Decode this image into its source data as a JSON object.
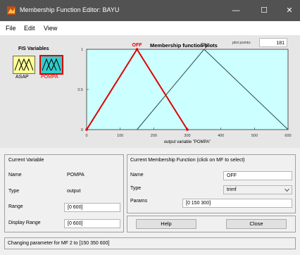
{
  "window": {
    "title": "Membership Function Editor: BAYU",
    "minimize": "—",
    "maximize": "☐",
    "close": "✕"
  },
  "menu": [
    "File",
    "Edit",
    "View"
  ],
  "fis_variables": {
    "title": "FIS Variables",
    "items": [
      {
        "label": "ASAP",
        "selected": false,
        "color": "#000000"
      },
      {
        "label": "POMPA",
        "selected": true,
        "color": "#e00000"
      }
    ]
  },
  "plot": {
    "title": "Membership function plots",
    "plot_points_label": "plot points:",
    "plot_points_value": "181"
  },
  "chart_data": {
    "type": "line",
    "xlabel": "output variable \"POMPA\"",
    "xlim": [
      0,
      600
    ],
    "ylim": [
      0,
      1
    ],
    "xticks": [
      0,
      100,
      200,
      300,
      400,
      500,
      600
    ],
    "yticks": [
      0,
      0.5,
      1
    ],
    "series": [
      {
        "name": "OFF",
        "points": [
          [
            0,
            0
          ],
          [
            150,
            1
          ],
          [
            300,
            0
          ]
        ],
        "color": "#e00000",
        "selected": true
      },
      {
        "name": "ON",
        "points": [
          [
            150,
            0
          ],
          [
            350,
            1
          ],
          [
            600,
            0
          ]
        ],
        "color": "#2d4a4a",
        "selected": false
      }
    ],
    "background": "#ccffff"
  },
  "current_variable": {
    "header": "Current Variable",
    "name_label": "Name",
    "name_value": "POMPA",
    "type_label": "Type",
    "type_value": "output",
    "range_label": "Range",
    "range_value": "[0 600]",
    "display_range_label": "Display Range",
    "display_range_value": "[0 600]"
  },
  "current_mf": {
    "header": "Current Membership Function (click on MF to select)",
    "name_label": "Name",
    "name_value": "OFF",
    "type_label": "Type",
    "type_value": "trimf",
    "params_label": "Params",
    "params_value": "[0 150 300]"
  },
  "buttons": {
    "help": "Help",
    "close": "Close"
  },
  "status": "Changing parameter for MF 2 to  [150 350 600]"
}
